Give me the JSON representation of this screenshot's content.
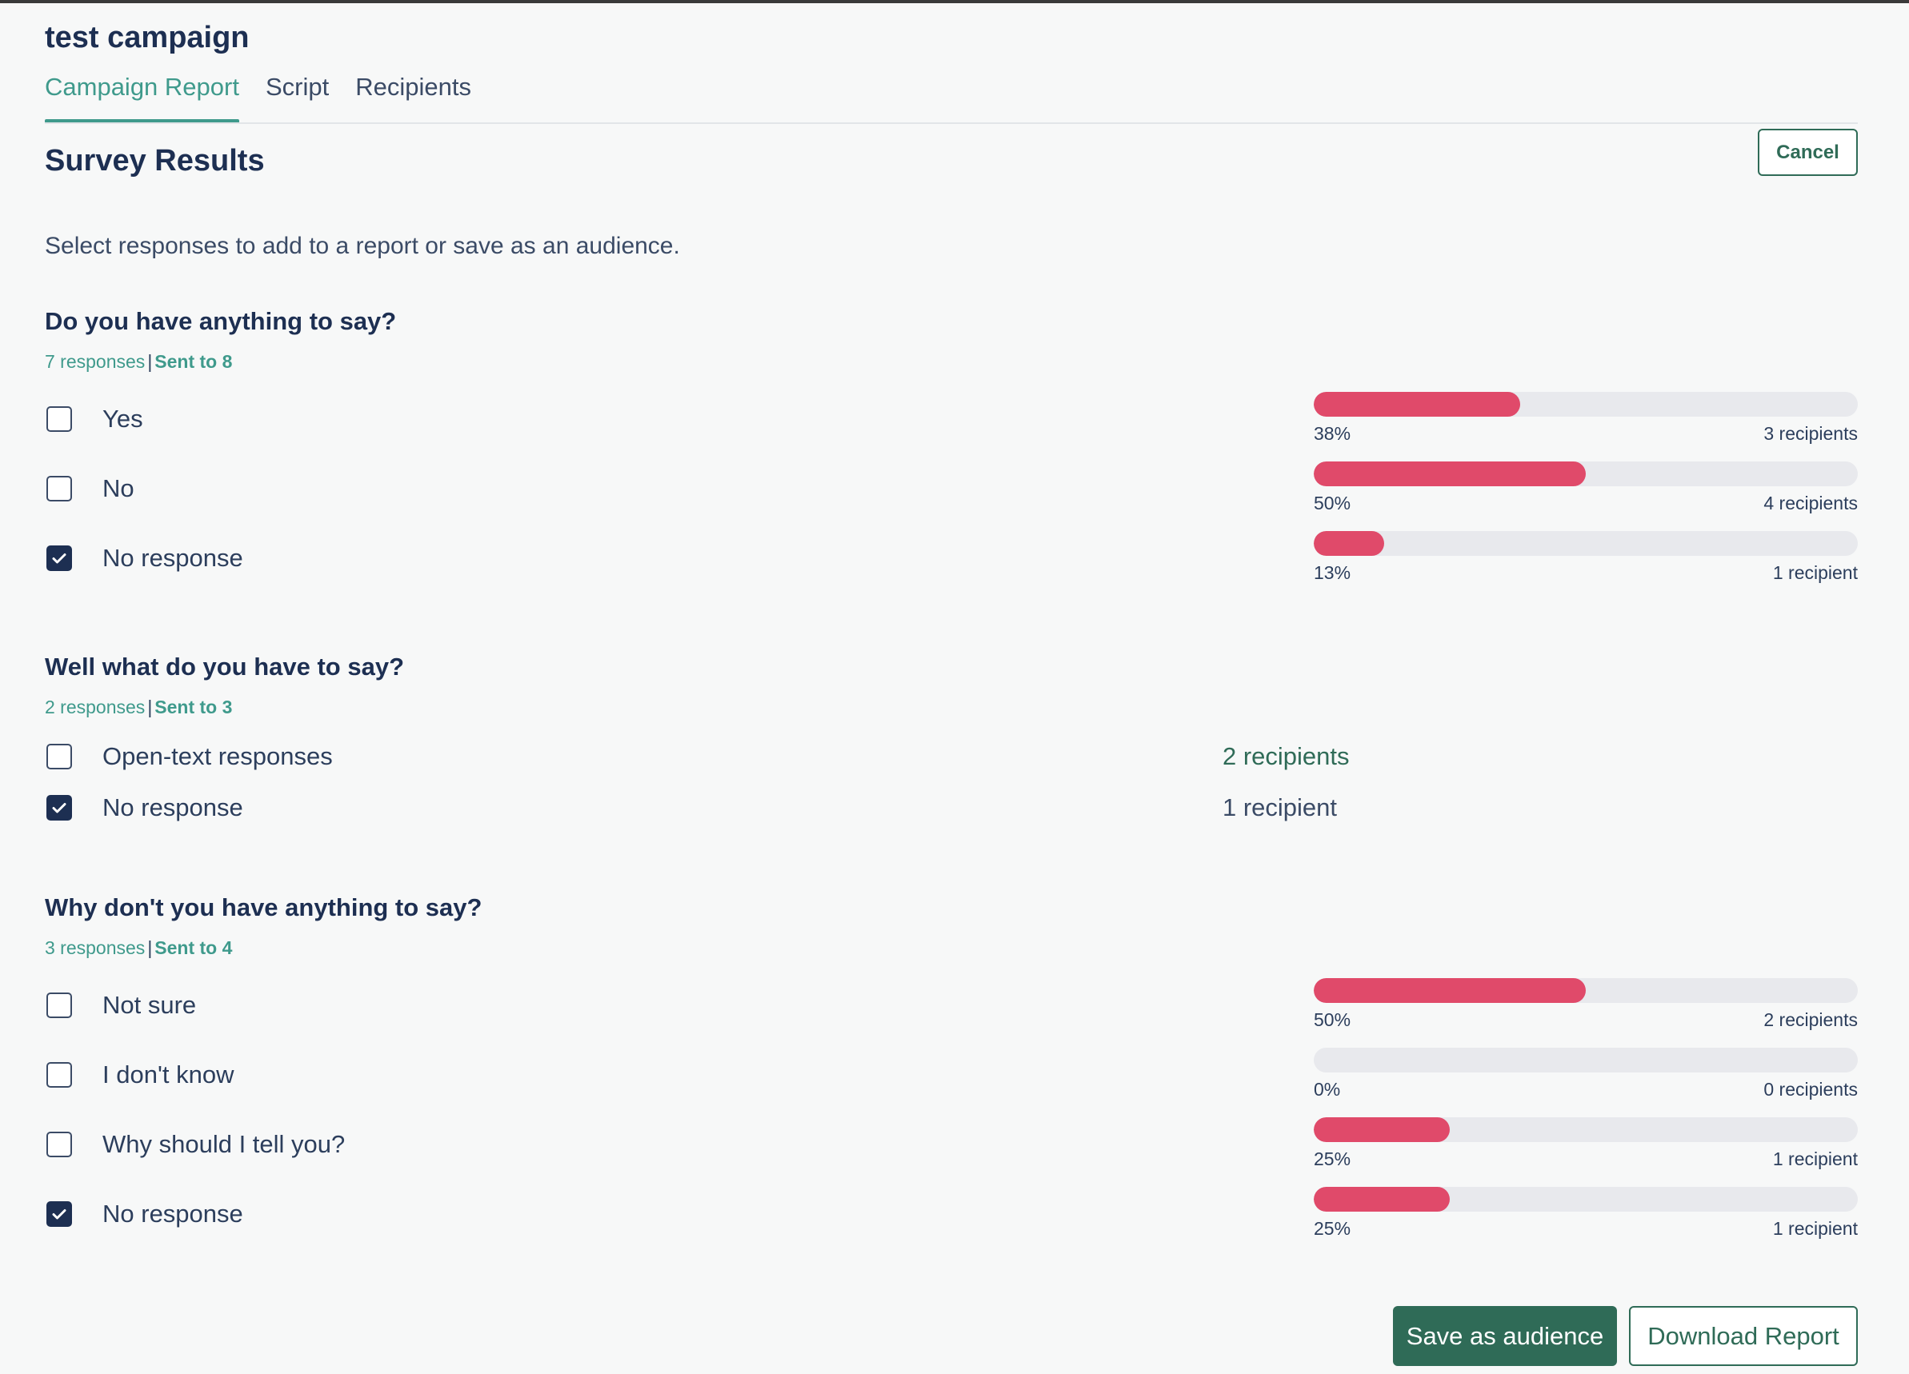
{
  "campaign": {
    "title": "test campaign"
  },
  "tabs": [
    {
      "label": "Campaign Report",
      "active": true
    },
    {
      "label": "Script",
      "active": false
    },
    {
      "label": "Recipients",
      "active": false
    }
  ],
  "section": {
    "title": "Survey Results",
    "cancel_label": "Cancel",
    "instructions": "Select responses to add to a report or save as an audience."
  },
  "questions": [
    {
      "title": "Do you have anything to say?",
      "responses": "7 responses",
      "separator": "|",
      "sent": "Sent to 8",
      "options": [
        {
          "label": "Yes",
          "checked": false,
          "percent": 38,
          "percent_label": "38%",
          "recipients": "3 recipients"
        },
        {
          "label": "No",
          "checked": false,
          "percent": 50,
          "percent_label": "50%",
          "recipients": "4 recipients"
        },
        {
          "label": "No response",
          "checked": true,
          "percent": 13,
          "percent_label": "13%",
          "recipients": "1 recipient"
        }
      ]
    },
    {
      "title": "Well what do you have to say?",
      "responses": "2 responses",
      "separator": "|",
      "sent": "Sent to 3",
      "options": [
        {
          "label": "Open-text responses",
          "checked": false,
          "recipients": "2 recipients"
        },
        {
          "label": "No response",
          "checked": true,
          "recipients": "1 recipient"
        }
      ]
    },
    {
      "title": "Why don't you have anything to say?",
      "responses": "3 responses",
      "separator": "|",
      "sent": "Sent to 4",
      "options": [
        {
          "label": "Not sure",
          "checked": false,
          "percent": 50,
          "percent_label": "50%",
          "recipients": "2 recipients"
        },
        {
          "label": "I don't know",
          "checked": false,
          "percent": 0,
          "percent_label": "0%",
          "recipients": "0 recipients"
        },
        {
          "label": "Why should I tell you?",
          "checked": false,
          "percent": 25,
          "percent_label": "25%",
          "recipients": "1 recipient"
        },
        {
          "label": "No response",
          "checked": true,
          "percent": 25,
          "percent_label": "25%",
          "recipients": "1 recipient"
        }
      ]
    }
  ],
  "actions": {
    "save_label": "Save as audience",
    "download_label": "Download Report"
  },
  "colors": {
    "accent": "#3f9a8c",
    "primary_button": "#2f6b57",
    "bar_fill": "#e04a6a",
    "bar_track": "#e8e9ed",
    "heading": "#1d2f52"
  }
}
